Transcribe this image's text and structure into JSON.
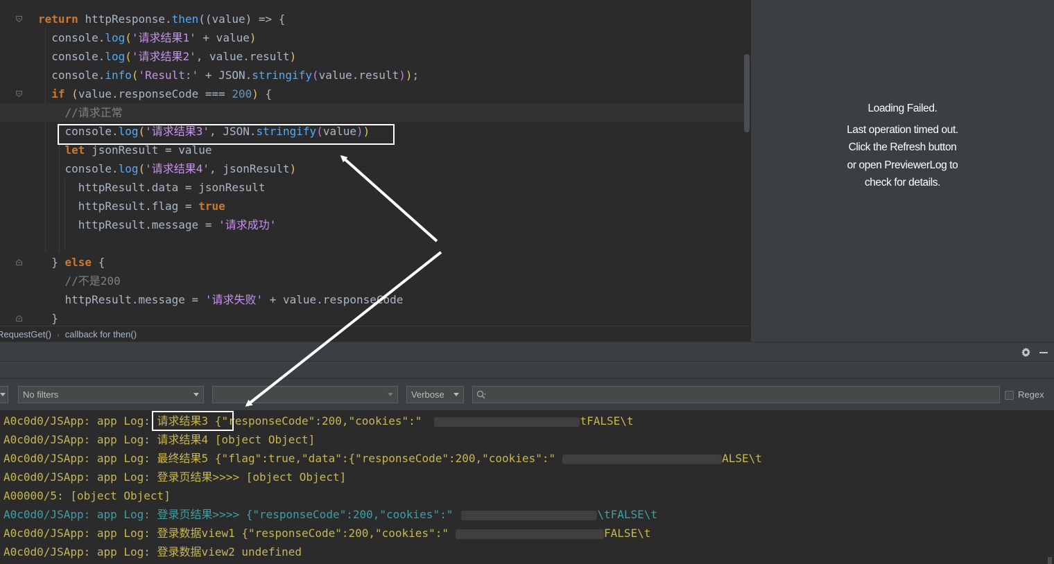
{
  "editor": {
    "lines": [
      [
        [
          "kw",
          "return "
        ],
        [
          "op",
          "httpResponse."
        ],
        [
          "fn",
          "then"
        ],
        [
          "op",
          "(("
        ],
        [
          "op",
          "value"
        ],
        [
          "op",
          ") => {"
        ]
      ],
      [
        [
          "op",
          "  console."
        ],
        [
          "fn",
          "log"
        ],
        [
          "pa",
          "("
        ],
        [
          "strp",
          "'请求结果1'"
        ],
        [
          "op",
          " + value"
        ],
        [
          "pa",
          ")"
        ]
      ],
      [
        [
          "op",
          "  console."
        ],
        [
          "fn",
          "log"
        ],
        [
          "pa",
          "("
        ],
        [
          "strp",
          "'请求结果2'"
        ],
        [
          "op",
          ", value.result"
        ],
        [
          "pa",
          ")"
        ]
      ],
      [
        [
          "op",
          "  console."
        ],
        [
          "fn",
          "info"
        ],
        [
          "pa",
          "("
        ],
        [
          "strp",
          "'Result:'"
        ],
        [
          "op",
          " + JSON."
        ],
        [
          "fn",
          "stringify"
        ],
        [
          "pa2",
          "("
        ],
        [
          "op",
          "value.result"
        ],
        [
          "pa2",
          ")"
        ],
        [
          "pa",
          ")"
        ],
        [
          "op",
          ";"
        ]
      ],
      [
        [
          "kw",
          "  if "
        ],
        [
          "pa",
          "("
        ],
        [
          "op",
          "value.responseCode === "
        ],
        [
          "num",
          "200"
        ],
        [
          "pa",
          ")"
        ],
        [
          "op",
          " {"
        ]
      ],
      [
        [
          "cm",
          "    //请求正常"
        ]
      ],
      [
        [
          "op",
          "    console."
        ],
        [
          "fn",
          "log"
        ],
        [
          "pa",
          "("
        ],
        [
          "strp",
          "'请求结果3'"
        ],
        [
          "op",
          ", JSON."
        ],
        [
          "fn",
          "stringify"
        ],
        [
          "pa2",
          "("
        ],
        [
          "op",
          "value"
        ],
        [
          "pa2",
          ")"
        ],
        [
          "pa",
          ")"
        ]
      ],
      [
        [
          "kw",
          "    let "
        ],
        [
          "op",
          "jsonResult = value"
        ]
      ],
      [
        [
          "op",
          "    console."
        ],
        [
          "fn",
          "log"
        ],
        [
          "pa",
          "("
        ],
        [
          "strp",
          "'请求结果4'"
        ],
        [
          "op",
          ", jsonResult"
        ],
        [
          "pa",
          ")"
        ]
      ],
      [
        [
          "op",
          "      httpResult.data = jsonResult"
        ]
      ],
      [
        [
          "op",
          "      httpResult.flag = "
        ],
        [
          "kw",
          "true"
        ]
      ],
      [
        [
          "op",
          "      httpResult.message = "
        ],
        [
          "strp",
          "'请求成功'"
        ]
      ],
      [
        [
          "op",
          ""
        ]
      ],
      [
        [
          "op",
          "  } "
        ],
        [
          "kw",
          "else"
        ],
        [
          "op",
          " {"
        ]
      ],
      [
        [
          "cm",
          "    //不是200"
        ]
      ],
      [
        [
          "op",
          "    httpResult.message = "
        ],
        [
          "strp",
          "'请求失败'"
        ],
        [
          "op",
          " + value.responseCode"
        ]
      ],
      [
        [
          "op",
          "  }"
        ]
      ]
    ]
  },
  "preview": {
    "line1": "Loading Failed.",
    "line2": "Last operation timed out.",
    "line3": "Click the Refresh button",
    "line4": "or open PreviewerLog to",
    "line5": "check for details."
  },
  "breadcrumb": {
    "item1": "RequestGet()",
    "item2": "callback for then()"
  },
  "filters": {
    "device_combo": "",
    "filter_combo": "No filters",
    "process_combo": "",
    "level_combo": "Verbose",
    "search_value": "",
    "regex_label": "Regex"
  },
  "log": {
    "lines": [
      {
        "level": "warn",
        "text": "A0c0d0/JSApp: app Log: 请求结果3 {\"responseCode\":200,\"cookies\":\"",
        "tail": "tFALSE\\t",
        "redact": [
          210,
          18
        ]
      },
      {
        "level": "warn",
        "text": "A0c0d0/JSApp: app Log: 请求结果4 [object Object]",
        "tail": "",
        "redact": []
      },
      {
        "level": "warn",
        "text": "A0c0d0/JSApp: app Log: 最终结果5 {\"flag\":true,\"data\":{\"responseCode\":200,\"cookies\":\"",
        "tail": "ALSE\\t",
        "redact": [
          230,
          10
        ]
      },
      {
        "level": "warn",
        "text": "A0c0d0/JSApp: app Log: 登录页结果>>>> [object Object]",
        "tail": "",
        "redact": []
      },
      {
        "level": "warn",
        "text": "A00000/5: [object Object]",
        "tail": "",
        "redact": []
      },
      {
        "level": "info",
        "text": "A0c0d0/JSApp: app Log: 登录页结果>>>> {\"responseCode\":200,\"cookies\":\"",
        "tail": "\\tFALSE\\t",
        "redact": [
          196,
          12
        ]
      },
      {
        "level": "warn",
        "text": "A0c0d0/JSApp: app Log: 登录数据view1 {\"responseCode\":200,\"cookies\":\"",
        "tail": "FALSE\\t",
        "redact": [
          214,
          10
        ]
      },
      {
        "level": "warn",
        "text": "A0c0d0/JSApp: app Log: 登录数据view2 undefined",
        "tail": "",
        "redact": []
      }
    ]
  },
  "colors": {
    "editor_bg": "#2b2b2b",
    "panel_bg": "#3c3f41",
    "log_warn": "#c7b651",
    "log_info": "#3e9fa7",
    "annotation": "#ffffff"
  },
  "icons": {
    "fold": "fold-arrow-icon",
    "bulb": "lightbulb-icon",
    "gear": "gear-icon",
    "minimize": "minimize-icon",
    "search": "search-icon"
  }
}
